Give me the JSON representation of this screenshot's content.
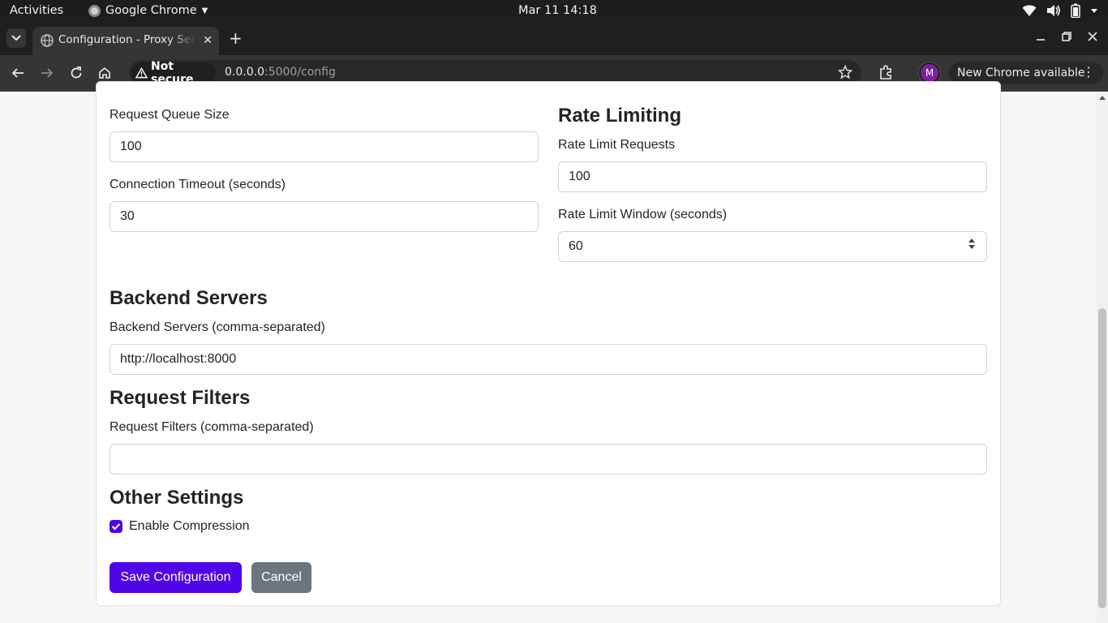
{
  "system_bar": {
    "activities": "Activities",
    "app_name": "Google Chrome",
    "clock": "Mar 11  14:18"
  },
  "browser": {
    "tab_title": "Configuration - Proxy Server",
    "security_chip": "Not secure",
    "url_host": "0.0.0.0",
    "url_rest": ":5000/config",
    "avatar_letter": "M",
    "update_label": "New Chrome available"
  },
  "form": {
    "request_queue_size": {
      "label": "Request Queue Size",
      "value": "100"
    },
    "connection_timeout": {
      "label": "Connection Timeout (seconds)",
      "value": "30"
    },
    "rate_limiting": {
      "heading": "Rate Limiting",
      "requests": {
        "label": "Rate Limit Requests",
        "value": "100"
      },
      "window": {
        "label": "Rate Limit Window (seconds)",
        "value": "60"
      }
    },
    "backend": {
      "heading": "Backend Servers",
      "label": "Backend Servers (comma-separated)",
      "value": "http://localhost:8000"
    },
    "filters": {
      "heading": "Request Filters",
      "label": "Request Filters (comma-separated)",
      "value": ""
    },
    "other": {
      "heading": "Other Settings",
      "compression_label": "Enable Compression",
      "compression_checked": true
    },
    "save_label": "Save Configuration",
    "cancel_label": "Cancel"
  },
  "colors": {
    "primary": "#5106e8",
    "secondary": "#6c757d"
  }
}
